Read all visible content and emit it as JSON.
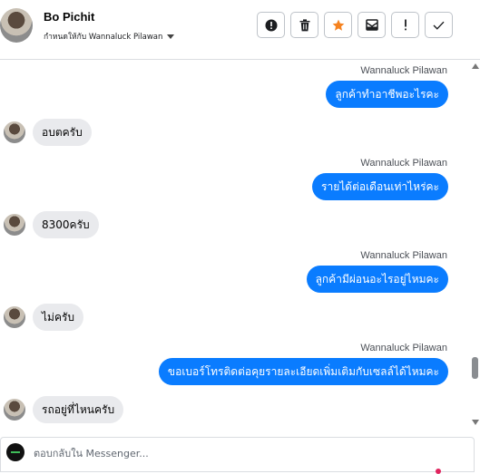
{
  "header": {
    "contact_name": "Bo Pichit",
    "assignee_label": "กำหนดให้กับ Wannaluck Pilawan",
    "actions": [
      {
        "icon": "alert-circle-icon"
      },
      {
        "icon": "trash-icon"
      },
      {
        "icon": "star-icon",
        "color": "#f5821f"
      },
      {
        "icon": "mail-archive-icon"
      },
      {
        "icon": "exclamation-icon"
      },
      {
        "icon": "checkmark-icon"
      }
    ]
  },
  "thread": {
    "messages": [
      {
        "direction": "out",
        "sender": "Wannaluck Pilawan",
        "text": "ลูกค้าทำอาชีพอะไรคะ"
      },
      {
        "direction": "in",
        "text": "อบตครับ"
      },
      {
        "direction": "out",
        "sender": "Wannaluck Pilawan",
        "text": "รายได้ต่อเดือนเท่าไหร่คะ"
      },
      {
        "direction": "in",
        "text": "8300ครับ"
      },
      {
        "direction": "out",
        "sender": "Wannaluck Pilawan",
        "text": "ลูกค้ามีผ่อนอะไรอยู่ไหมคะ"
      },
      {
        "direction": "in",
        "text": "ไม่ครับ"
      },
      {
        "direction": "out",
        "sender": "Wannaluck Pilawan",
        "text": "ขอเบอร์โทรติดต่อคุยรายละเอียดเพิ่มเติมกับเซลล์ได้ไหมคะ"
      },
      {
        "direction": "in",
        "text": "รถอยู่ที่ไหนครับ"
      }
    ]
  },
  "composer": {
    "placeholder": "ตอบกลับใน Messenger...",
    "value": ""
  },
  "colors": {
    "outgoing_bubble": "#0a7cff",
    "incoming_bubble": "#e9eaed",
    "star": "#f5821f"
  }
}
